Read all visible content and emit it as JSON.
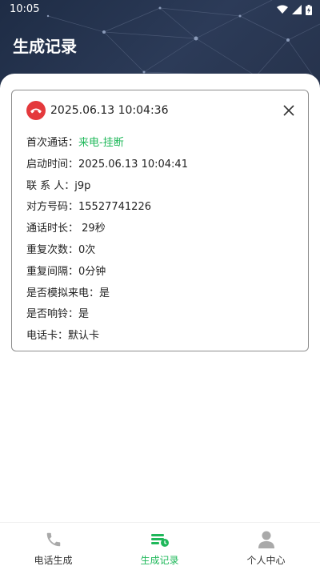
{
  "status_bar": {
    "time": "10:05"
  },
  "header": {
    "title": "生成记录"
  },
  "record": {
    "datetime": "2025.06.13 10:04:36",
    "fields": [
      {
        "label": "首次通话：",
        "value": "来电-挂断",
        "accent": true
      },
      {
        "label": "启动时间：",
        "value": "2025.06.13 10:04:41",
        "accent": false
      },
      {
        "label": "联 系 人：",
        "value": "j9p",
        "accent": false
      },
      {
        "label": "对方号码：",
        "value": "15527741226",
        "accent": false
      },
      {
        "label": "通话时长：",
        "value": " 29秒",
        "accent": false
      },
      {
        "label": "重复次数：",
        "value": "0次",
        "accent": false
      },
      {
        "label": "重复间隔：",
        "value": "0分钟",
        "accent": false
      },
      {
        "label": "是否模拟来电：",
        "value": "是",
        "accent": false
      },
      {
        "label": "是否响铃：",
        "value": "是",
        "accent": false
      },
      {
        "label": "电话卡：",
        "value": "默认卡",
        "accent": false
      }
    ]
  },
  "tabs": [
    {
      "label": "电话生成",
      "icon": "phone-icon",
      "active": false
    },
    {
      "label": "生成记录",
      "icon": "records-icon",
      "active": true
    },
    {
      "label": "个人中心",
      "icon": "person-icon",
      "active": false
    }
  ],
  "colors": {
    "accent": "#1fb85a",
    "hangup": "#e4393c",
    "header": "#26324b"
  }
}
